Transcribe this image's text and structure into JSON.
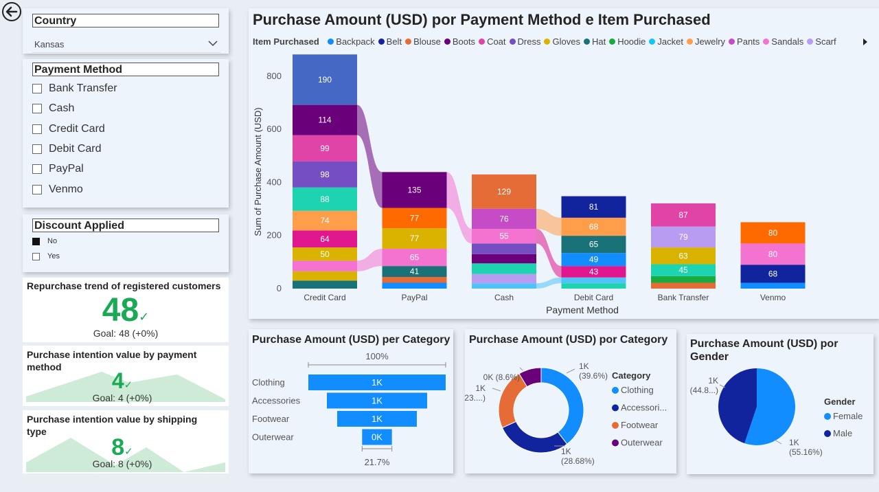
{
  "nav": {
    "back_icon": "back-arrow-icon"
  },
  "country_slicer": {
    "title": "Country",
    "selected": "Kansas"
  },
  "payment_slicer": {
    "title": "Payment Method",
    "options": [
      "Bank Transfer",
      "Cash",
      "Credit Card",
      "Debit Card",
      "PayPal",
      "Venmo"
    ]
  },
  "discount_slicer": {
    "title": "Discount Applied",
    "options": [
      {
        "label": "No",
        "checked": true
      },
      {
        "label": "Yes",
        "checked": false
      }
    ]
  },
  "kpis": [
    {
      "title": "Repurchase trend of registered customers",
      "value": "48",
      "goal": "Goal: 48 (+0%)"
    },
    {
      "title": "Purchase intention value by payment method",
      "value": "4",
      "goal": "Goal: 4 (+0%)"
    },
    {
      "title": "Purchase intention value by shipping type",
      "value": "8",
      "goal": "Goal: 8 (+0%)"
    }
  ],
  "main_chart": {
    "title": "Purchase Amount (USD) por Payment Method e Item Purchased",
    "legend_title": "Item Purchased",
    "legend": [
      {
        "name": "Backpack",
        "color": "#118DFF"
      },
      {
        "name": "Belt",
        "color": "#12239E"
      },
      {
        "name": "Blouse",
        "color": "#E66C37"
      },
      {
        "name": "Boots",
        "color": "#6B007B"
      },
      {
        "name": "Coat",
        "color": "#E044A7"
      },
      {
        "name": "Dress",
        "color": "#744EC2"
      },
      {
        "name": "Gloves",
        "color": "#D9B300"
      },
      {
        "name": "Hat",
        "color": "#197278"
      },
      {
        "name": "Hoodie",
        "color": "#1AAB40"
      },
      {
        "name": "Jacket",
        "color": "#15C6F4"
      },
      {
        "name": "Jewelry",
        "color": "#FF9E4A"
      },
      {
        "name": "Pants",
        "color": "#C64CC7"
      },
      {
        "name": "Sandals",
        "color": "#F472D0"
      },
      {
        "name": "Scarf",
        "color": "#B79CF2"
      }
    ]
  },
  "chart_data": [
    {
      "type": "bar",
      "title": "Purchase Amount (USD) por Payment Method e Item Purchased",
      "xlabel": "Payment Method",
      "ylabel": "Sum of Purchase Amount (USD)",
      "ylim": [
        0,
        880
      ],
      "yticks": [
        0,
        200,
        400,
        600,
        800
      ],
      "categories": [
        "Credit Card",
        "PayPal",
        "Cash",
        "Debit Card",
        "Bank Transfer",
        "Venmo"
      ],
      "stacks": [
        [
          {
            "value": 30,
            "color": "#197278",
            "label": ""
          },
          {
            "value": 35,
            "color": "#D9B300",
            "label": ""
          },
          {
            "value": 40,
            "color": "#F472D0",
            "label": ""
          },
          {
            "value": 50,
            "color": "#D9B300",
            "label": "50"
          },
          {
            "value": 64,
            "color": "#E0168C",
            "label": "64"
          },
          {
            "value": 74,
            "color": "#FF9E4A",
            "label": "74"
          },
          {
            "value": 88,
            "color": "#1DD3B0",
            "label": "88"
          },
          {
            "value": 98,
            "color": "#744EC2",
            "label": "98"
          },
          {
            "value": 99,
            "color": "#E044A7",
            "label": "99"
          },
          {
            "value": 114,
            "color": "#6B007B",
            "label": "114"
          },
          {
            "value": 190,
            "color": "#4668C5",
            "label": "190"
          }
        ],
        [
          {
            "value": 22,
            "color": "#118DFF",
            "label": ""
          },
          {
            "value": 22,
            "color": "#E66C37",
            "label": ""
          },
          {
            "value": 41,
            "color": "#197278",
            "label": "41"
          },
          {
            "value": 65,
            "color": "#F472D0",
            "label": "65"
          },
          {
            "value": 77,
            "color": "#D9B300",
            "label": "77"
          },
          {
            "value": 77,
            "color": "#FF6A00",
            "label": "77"
          },
          {
            "value": 135,
            "color": "#6B007B",
            "label": "135"
          }
        ],
        [
          {
            "value": 20,
            "color": "#4FC3F7",
            "label": ""
          },
          {
            "value": 35,
            "color": "#B79CF2",
            "label": ""
          },
          {
            "value": 40,
            "color": "#1DD3B0",
            "label": ""
          },
          {
            "value": 35,
            "color": "#6B007B",
            "label": ""
          },
          {
            "value": 40,
            "color": "#744EC2",
            "label": ""
          },
          {
            "value": 55,
            "color": "#F472D0",
            "label": "55"
          },
          {
            "value": 76,
            "color": "#C64CC7",
            "label": "76"
          },
          {
            "value": 129,
            "color": "#E66C37",
            "label": "129"
          }
        ],
        [
          {
            "value": 20,
            "color": "#1DD3B0",
            "label": ""
          },
          {
            "value": 22,
            "color": "#4FC3F7",
            "label": ""
          },
          {
            "value": 43,
            "color": "#E0168C",
            "label": "43"
          },
          {
            "value": 49,
            "color": "#118DFF",
            "label": "49"
          },
          {
            "value": 65,
            "color": "#197278",
            "label": "65"
          },
          {
            "value": 68,
            "color": "#FF9E4A",
            "label": "68"
          },
          {
            "value": 81,
            "color": "#12239E",
            "label": "81"
          }
        ],
        [
          {
            "value": 22,
            "color": "#E66C37",
            "label": ""
          },
          {
            "value": 25,
            "color": "#1AAB40",
            "label": ""
          },
          {
            "value": 45,
            "color": "#1DD3B0",
            "label": "45"
          },
          {
            "value": 63,
            "color": "#D9B300",
            "label": "63"
          },
          {
            "value": 79,
            "color": "#B79CF2",
            "label": "79"
          },
          {
            "value": 87,
            "color": "#E044A7",
            "label": "87"
          }
        ],
        [
          {
            "value": 22,
            "color": "#118DFF",
            "label": ""
          },
          {
            "value": 68,
            "color": "#12239E",
            "label": "68"
          },
          {
            "value": 80,
            "color": "#F472D0",
            "label": "80"
          },
          {
            "value": 80,
            "color": "#FF6A00",
            "label": "80"
          }
        ]
      ]
    },
    {
      "type": "bar",
      "title": "Purchase Amount (USD) per Category",
      "categories": [
        "Clothing",
        "Accessories",
        "Footwear",
        "Outerwear"
      ],
      "values": [
        1.0,
        0.73,
        0.58,
        0.217
      ],
      "labels": [
        "1K",
        "1K",
        "1K",
        "0K"
      ],
      "top_label": "100%",
      "bottom_label": "21.7%"
    },
    {
      "type": "pie",
      "title": "Purchase Amount (USD) por Category",
      "legend_title": "Category",
      "slices": [
        {
          "name": "Clothing",
          "legend_name": "Clothing",
          "value": 39.6,
          "color": "#118DFF",
          "label": "1K",
          "pct": "(39.6%)"
        },
        {
          "name": "Accessories",
          "legend_name": "Accessori...",
          "value": 28.68,
          "color": "#12239E",
          "label": "1K",
          "pct": "(28.68%)"
        },
        {
          "name": "Footwear",
          "legend_name": "Footwear",
          "value": 23.12,
          "color": "#E66C37",
          "label": "1K",
          "pct": "(23....)"
        },
        {
          "name": "Outerwear",
          "legend_name": "Outerwear",
          "value": 8.6,
          "color": "#6B007B",
          "label": "0K (8.6%)",
          "pct": ""
        }
      ]
    },
    {
      "type": "pie",
      "title": "Purchase Amount (USD) por Gender",
      "legend_title": "Gender",
      "slices": [
        {
          "name": "Female",
          "value": 55.16,
          "color": "#118DFF",
          "label": "1K",
          "pct": "(55.16%)"
        },
        {
          "name": "Male",
          "value": 44.84,
          "color": "#12239E",
          "label": "1K",
          "pct": "(44.8...)"
        }
      ]
    }
  ]
}
